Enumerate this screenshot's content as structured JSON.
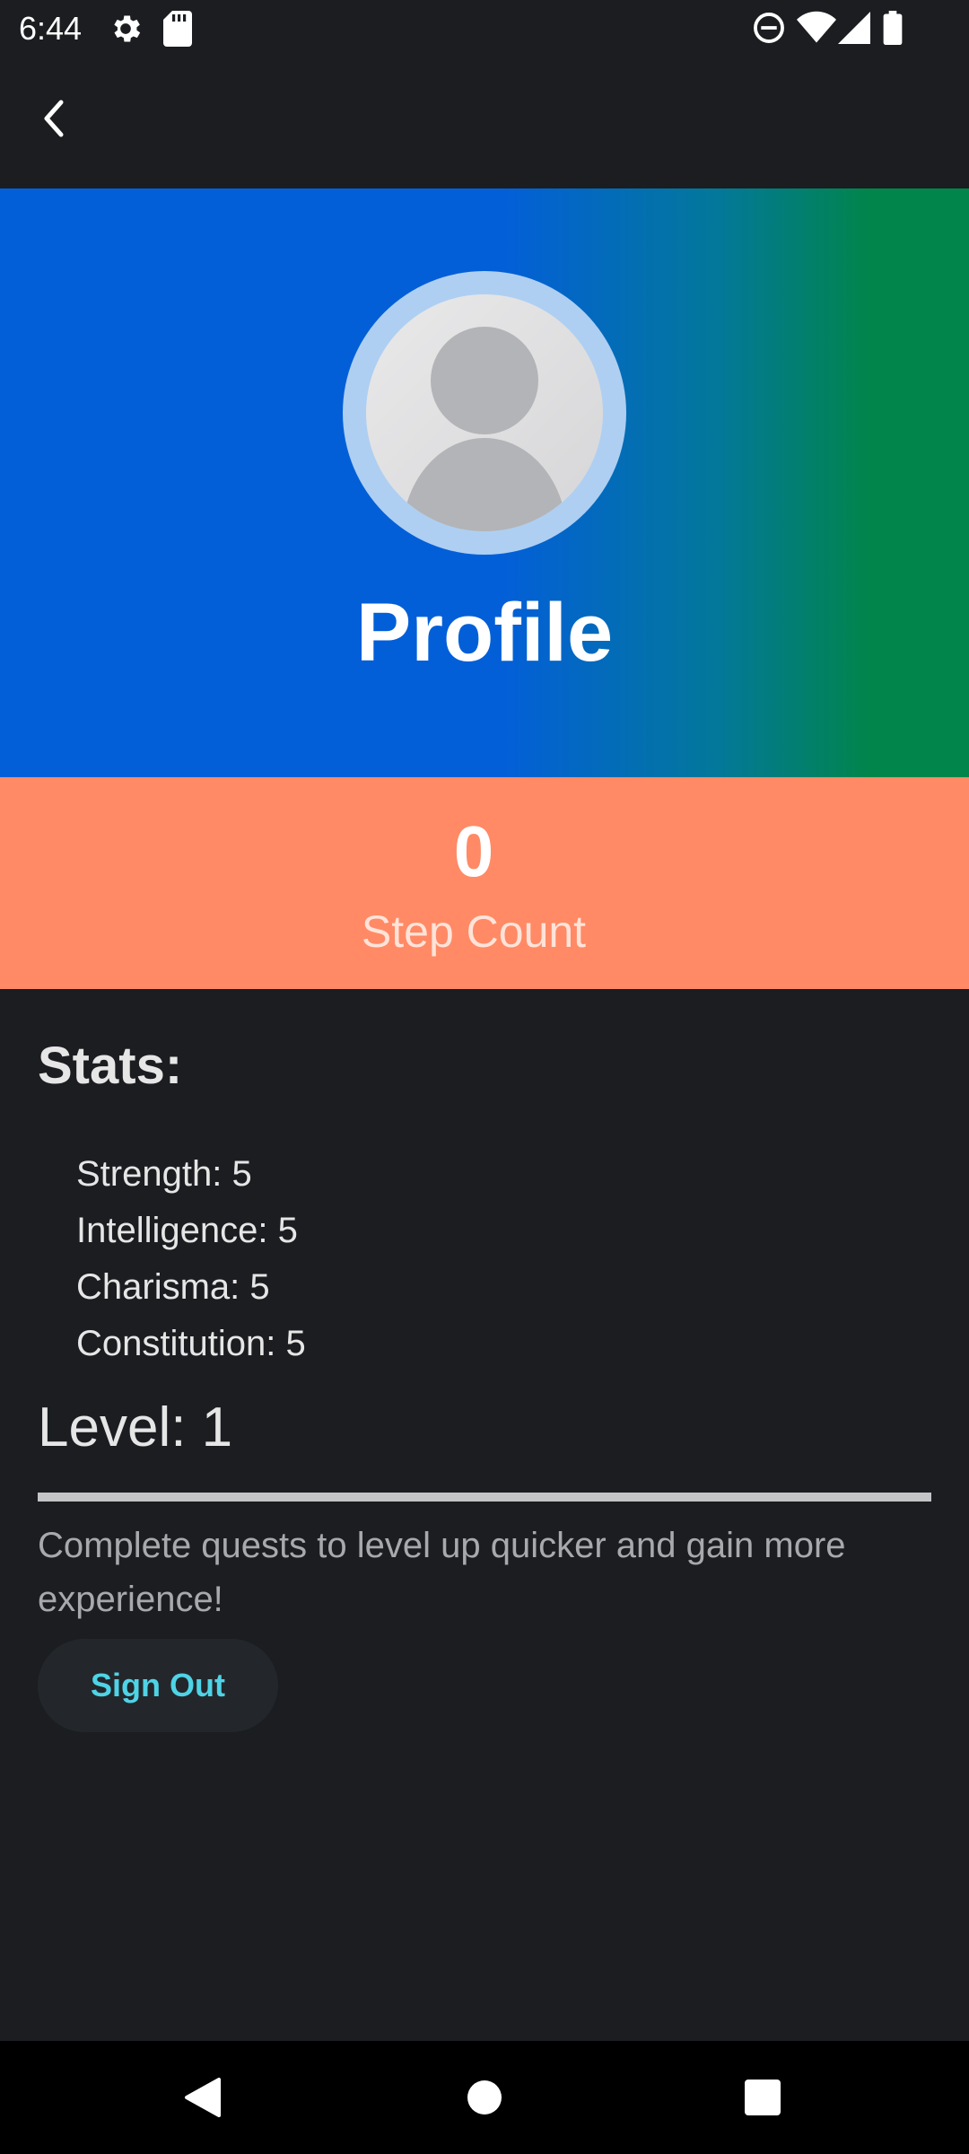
{
  "status_bar": {
    "time": "6:44",
    "icons": [
      "settings-icon",
      "sd-card-icon",
      "do-not-disturb-icon",
      "wifi-icon",
      "signal-icon",
      "battery-icon"
    ]
  },
  "app_bar": {
    "back_icon": "chevron-left-icon"
  },
  "header": {
    "title": "Profile",
    "avatar_icon": "person-placeholder-icon",
    "gradient_colors": [
      "#035fd8",
      "#02854a"
    ]
  },
  "steps": {
    "value": "0",
    "label": "Step Count",
    "background": "#ff8a65"
  },
  "stats": {
    "title": "Stats:",
    "items": [
      {
        "label": "Strength: 5"
      },
      {
        "label": "Intelligence: 5"
      },
      {
        "label": "Charisma: 5"
      },
      {
        "label": "Constitution: 5"
      }
    ]
  },
  "level": {
    "label": "Level: 1",
    "progress": 1.0,
    "hint": "Complete quests to level up quicker and gain more experience!"
  },
  "actions": {
    "sign_out": "Sign Out",
    "accent": "#4fd3e6"
  },
  "nav_bar": {
    "icons": [
      "back-triangle-icon",
      "home-circle-icon",
      "recents-square-icon"
    ]
  }
}
